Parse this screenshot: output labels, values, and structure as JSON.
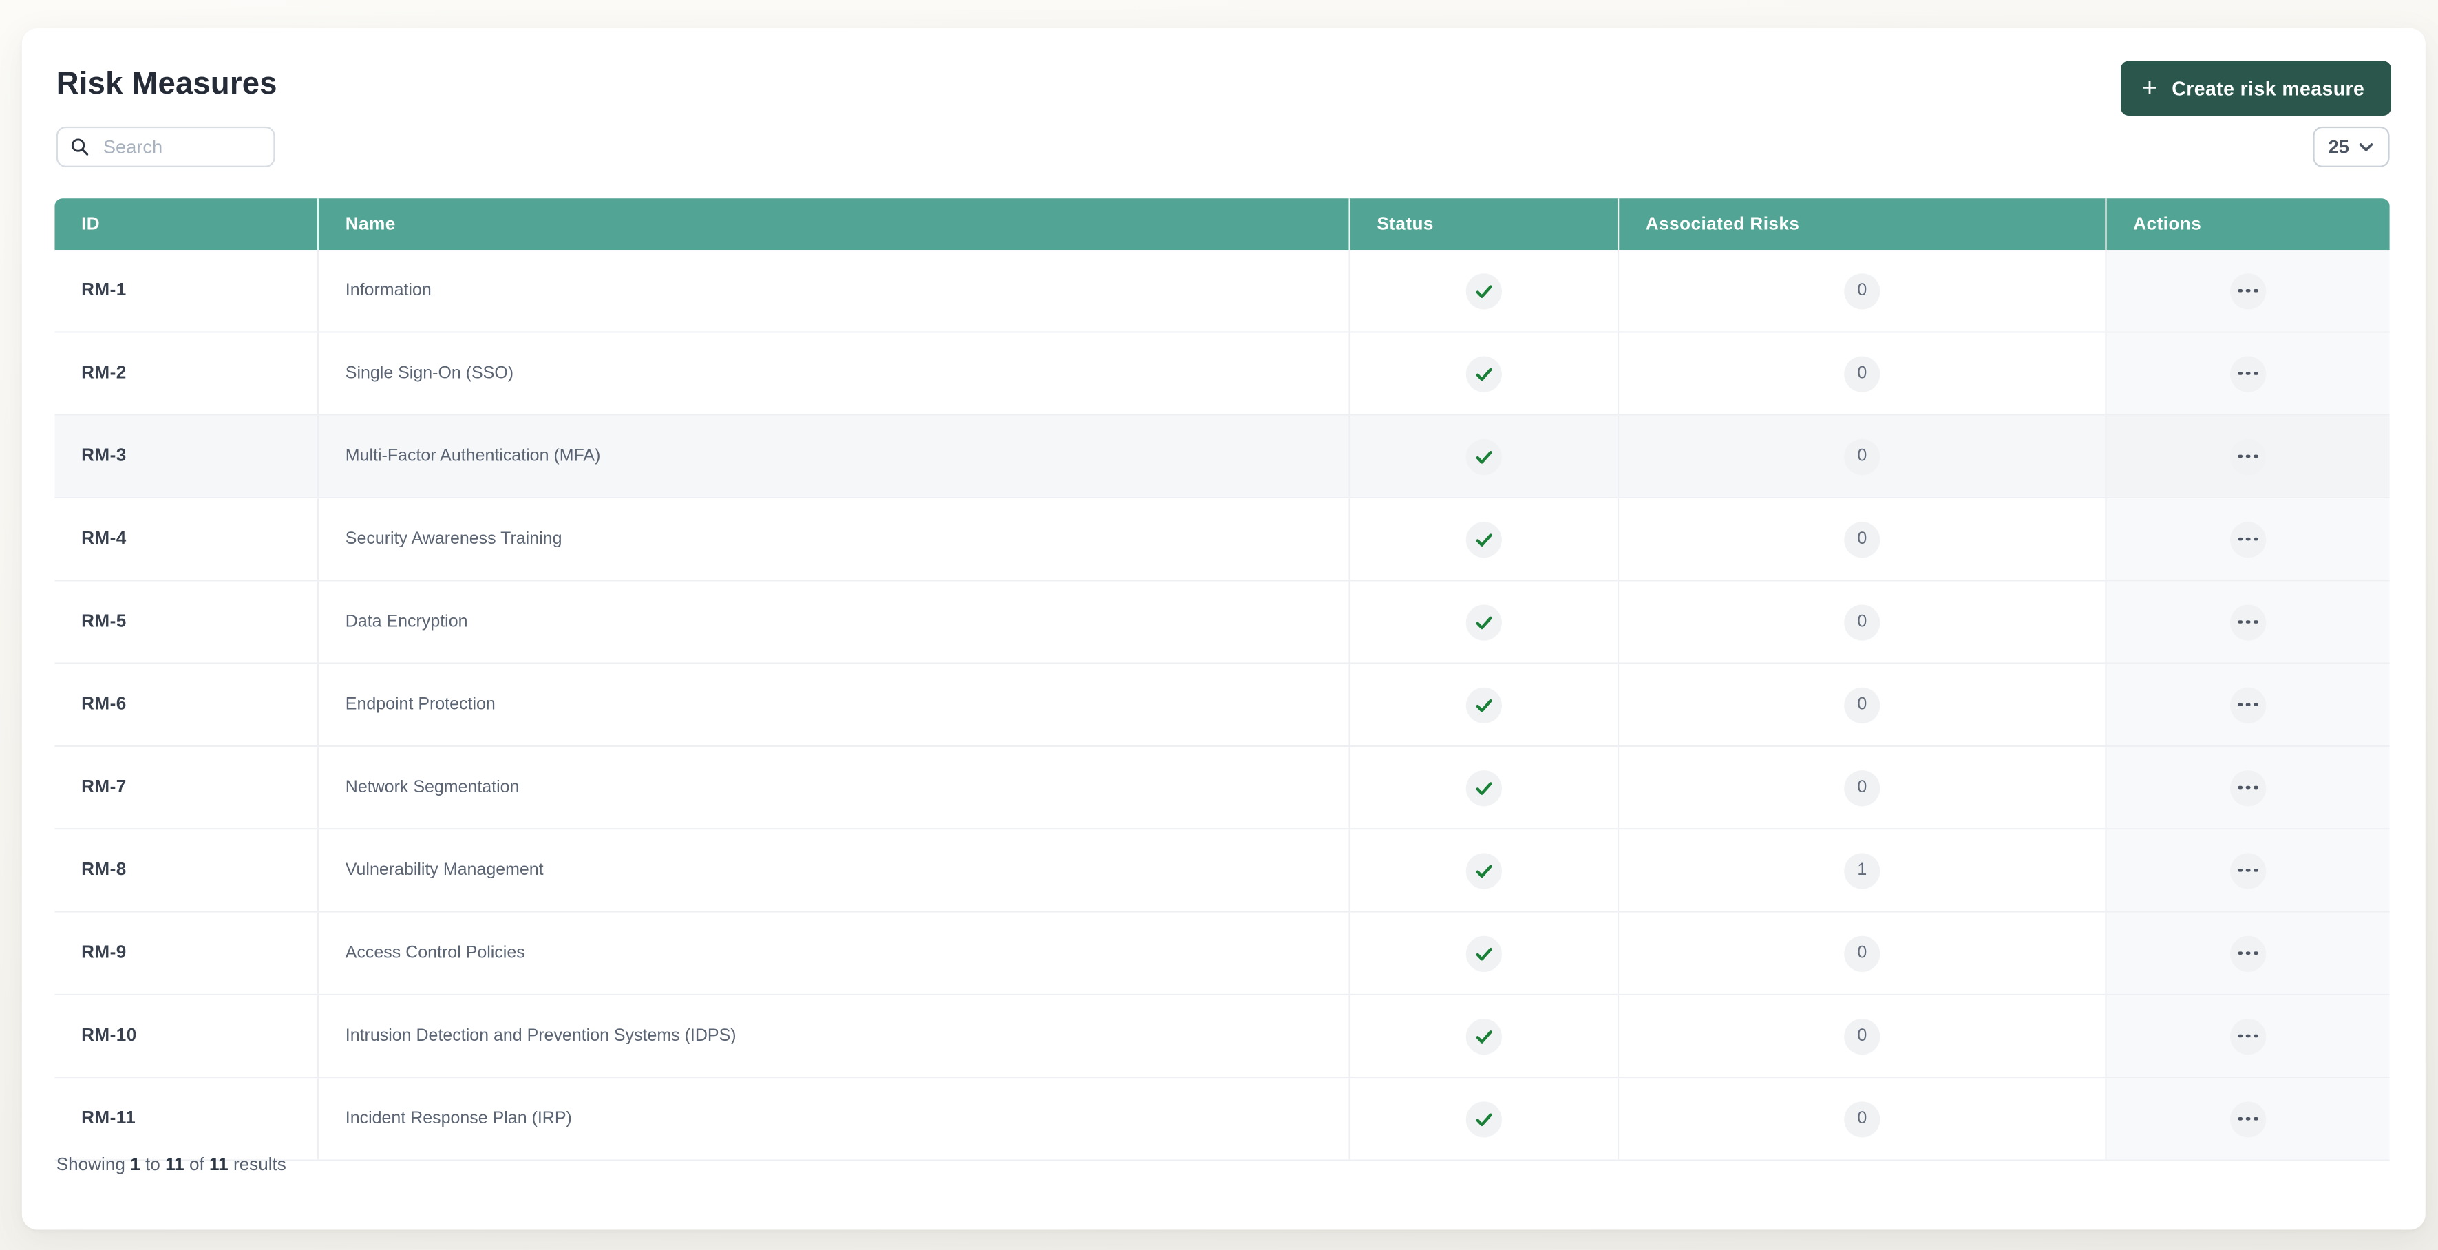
{
  "page": {
    "title": "Risk Measures"
  },
  "toolbar": {
    "create_button": {
      "label": "Create risk measure",
      "icon": "plus-icon",
      "plus_glyph": "+",
      "color": "#2b564c"
    },
    "search": {
      "placeholder": "Search",
      "value": "",
      "icon": "search-icon"
    },
    "page_size": {
      "value": "25",
      "icon": "chevron-down-icon"
    }
  },
  "table": {
    "columns": [
      "ID",
      "Name",
      "Status",
      "Associated Risks",
      "Actions"
    ],
    "header_color": "#52a494",
    "status_complete_icon": "check-icon",
    "actions_icon": "ellipsis-icon",
    "rows": [
      {
        "id": "RM-1",
        "name": "Information",
        "status": "complete",
        "associated_risks": "0"
      },
      {
        "id": "RM-2",
        "name": "Single Sign-On (SSO)",
        "status": "complete",
        "associated_risks": "0"
      },
      {
        "id": "RM-3",
        "name": "Multi-Factor Authentication (MFA)",
        "status": "complete",
        "associated_risks": "0",
        "highlighted": true
      },
      {
        "id": "RM-4",
        "name": "Security Awareness Training",
        "status": "complete",
        "associated_risks": "0"
      },
      {
        "id": "RM-5",
        "name": "Data Encryption",
        "status": "complete",
        "associated_risks": "0"
      },
      {
        "id": "RM-6",
        "name": "Endpoint Protection",
        "status": "complete",
        "associated_risks": "0"
      },
      {
        "id": "RM-7",
        "name": "Network Segmentation",
        "status": "complete",
        "associated_risks": "0"
      },
      {
        "id": "RM-8",
        "name": "Vulnerability Management",
        "status": "complete",
        "associated_risks": "1"
      },
      {
        "id": "RM-9",
        "name": "Access Control Policies",
        "status": "complete",
        "associated_risks": "0"
      },
      {
        "id": "RM-10",
        "name": "Intrusion Detection and Prevention Systems (IDPS)",
        "status": "complete",
        "associated_risks": "0"
      },
      {
        "id": "RM-11",
        "name": "Incident Response Plan (IRP)",
        "status": "complete",
        "associated_risks": "0"
      }
    ]
  },
  "footer": {
    "showing": "Showing",
    "from": "1",
    "to_label": "to",
    "to": "11",
    "of_label": "of",
    "total": "11",
    "results": "results"
  },
  "colors": {
    "accent_teal": "#52a494",
    "button_dark_green": "#2b564c",
    "check_green": "#1a8038",
    "row_highlight": "#f6f7f9",
    "badge_bg": "#f0f2f4",
    "page_background": "#f8f6f1"
  }
}
